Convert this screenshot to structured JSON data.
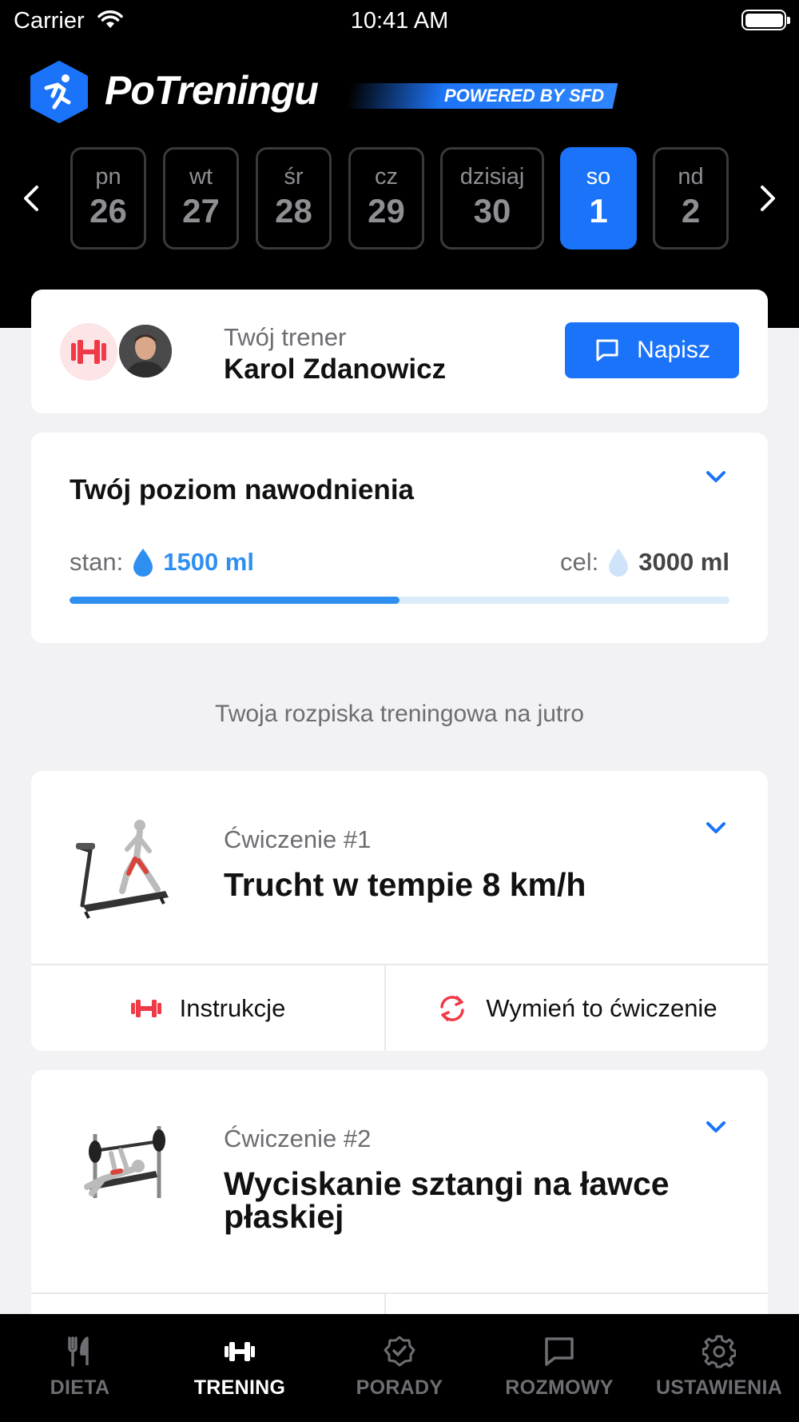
{
  "status_bar": {
    "carrier": "Carrier",
    "time": "10:41 AM"
  },
  "brand": {
    "name": "PoTreningu",
    "powered": "POWERED BY SFD",
    "accent": "#1a73f8"
  },
  "week": {
    "days": [
      {
        "name": "pn",
        "date": "26"
      },
      {
        "name": "wt",
        "date": "27"
      },
      {
        "name": "śr",
        "date": "28"
      },
      {
        "name": "cz",
        "date": "29"
      },
      {
        "name": "dzisiaj",
        "date": "30"
      },
      {
        "name": "so",
        "date": "1",
        "active": true
      },
      {
        "name": "nd",
        "date": "2"
      }
    ]
  },
  "coach": {
    "label": "Twój trener",
    "name": "Karol Zdanowicz",
    "button": "Napisz"
  },
  "hydration": {
    "title": "Twój poziom nawodnienia",
    "current_label": "stan:",
    "current_value": "1500 ml",
    "goal_label": "cel:",
    "goal_value": "3000 ml",
    "progress_percent": 50
  },
  "plan_title": "Twoja rozpiska treningowa na jutro",
  "exercises": [
    {
      "number": "Ćwiczenie #1",
      "name": "Trucht w tempie 8 km/h",
      "instructions": "Instrukcje",
      "swap": "Wymień to ćwiczenie"
    },
    {
      "number": "Ćwiczenie #2",
      "name": "Wyciskanie sztangi na ławce płaskiej"
    }
  ],
  "tabs": [
    {
      "label": "DIETA",
      "icon": "fork-knife-icon"
    },
    {
      "label": "TRENING",
      "icon": "dumbbell-icon",
      "active": true
    },
    {
      "label": "PORADY",
      "icon": "badge-check-icon"
    },
    {
      "label": "ROZMOWY",
      "icon": "chat-icon"
    },
    {
      "label": "USTAWIENIA",
      "icon": "gear-icon"
    }
  ]
}
